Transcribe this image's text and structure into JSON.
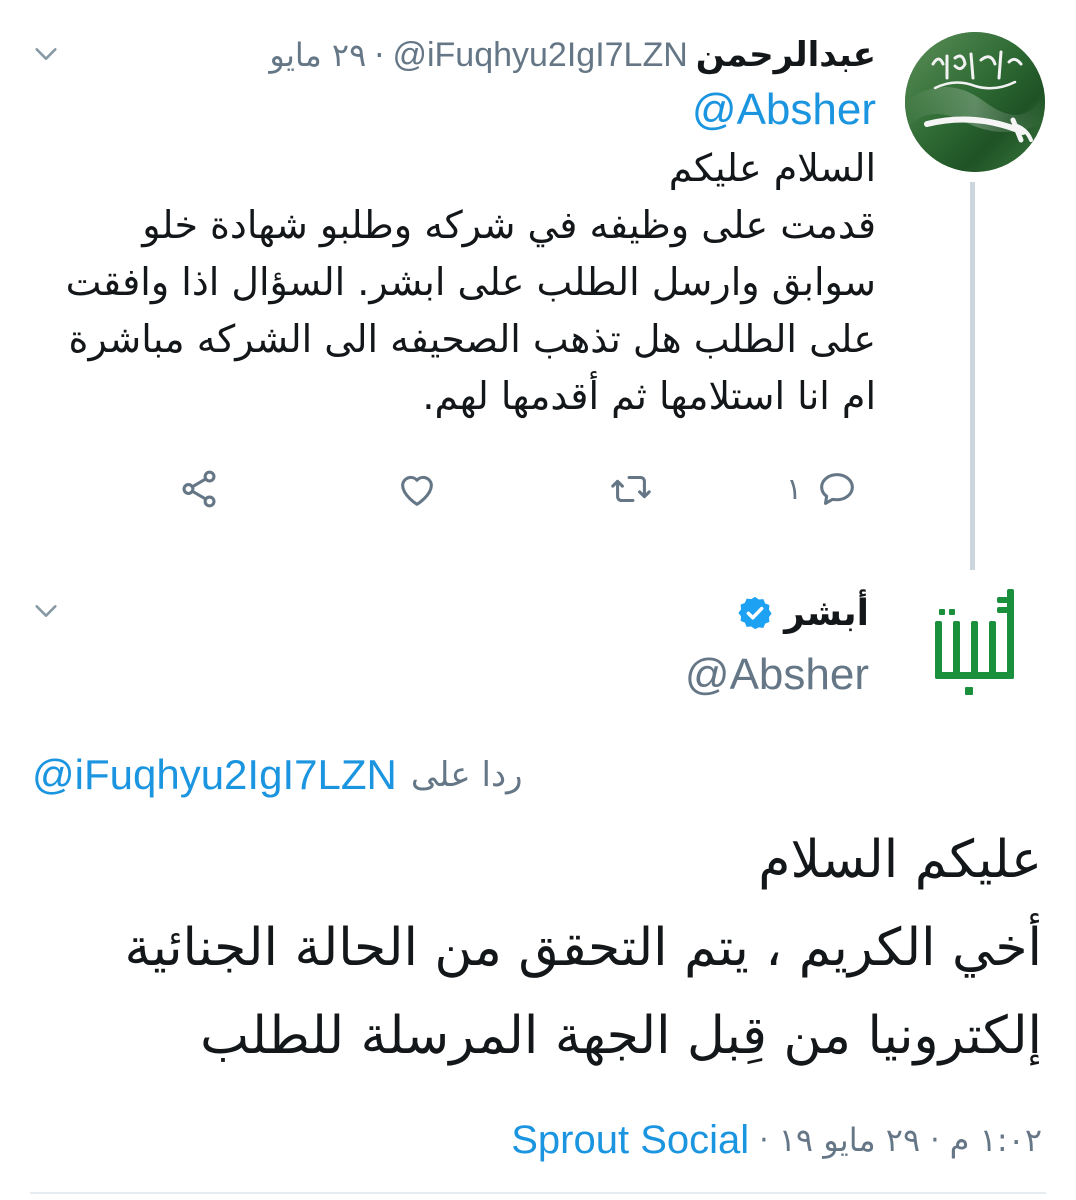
{
  "colors": {
    "link_blue": "#1b95e0",
    "secondary_gray": "#657786",
    "text_dark": "#14171a",
    "thread_line": "#ccd6dd",
    "flag_green": "#2f6b34",
    "absher_green": "#1a8f3c"
  },
  "icons": {
    "dropdown": "chevron-down-icon",
    "reply": "reply-icon",
    "retweet": "retweet-icon",
    "like": "heart-icon",
    "share": "share-icon",
    "verified": "verified-badge-icon"
  },
  "tweet1": {
    "avatar": "saudi-flag-avatar",
    "author_name": "عبدالرحمن",
    "handle": "@iFuqhyu2IgI7LZN",
    "separator": "·",
    "date": "٢٩ مايو",
    "mention": "@Absher",
    "body_lines": [
      "السلام عليكم",
      "قدمت على وظيفه في شركه وطلبو شهادة خلو",
      "سوابق وارسل الطلب على ابشر. السؤال اذا وافقت",
      "على الطلب هل تذهب الصحيفه الى الشركه مباشرة",
      "ام انا استلامها ثم أقدمها لهم."
    ],
    "actions": {
      "reply_count": "١",
      "retweet_count": "",
      "like_count": ""
    }
  },
  "tweet2": {
    "avatar": "absher-logo-avatar",
    "author_name": "أبشر",
    "handle": "@Absher",
    "reply_label": "ردا على",
    "reply_handle": "@iFuqhyu2IgI7LZN",
    "body_lines": [
      "عليكم السلام",
      "أخي الكريم ، يتم التحقق من الحالة الجنائية",
      "إلكترونيا من قِبل الجهة المرسلة للطلب"
    ],
    "time": "١:٠٢ م",
    "separator": "·",
    "date": "٢٩ مايو ١٩",
    "source": "Sprout Social"
  }
}
